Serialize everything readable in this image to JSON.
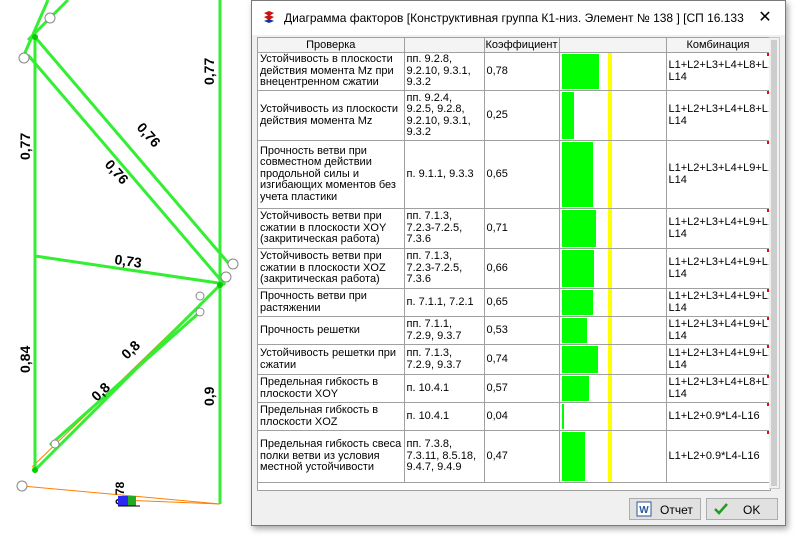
{
  "canvas": {
    "labels": {
      "top_diag_left": "0,77",
      "top_right_vert": "0,77",
      "diag_upper": "0,76",
      "diag_middle": "0,76",
      "horizontal": "0,73",
      "lower_left_vert": "0,84",
      "lower_diag_a": "0,8",
      "lower_diag_b": "0,8",
      "lower_right_vert": "0,9",
      "bottom_small": "0,78"
    }
  },
  "dialog": {
    "title": "Диаграмма факторов [Конструктивная группа К1-низ. Элемент № 138 ] [СП 16.13330...",
    "close_label": "✕",
    "columns": {
      "check": "Проверка",
      "clause": "",
      "coef": "Коэффициент",
      "bar": "",
      "combo": "Комбинация"
    },
    "rows": [
      {
        "check": "Устойчивость в плоскости действия момента Mz при внецентренном сжатии",
        "clause": "пп. 9.2.8, 9.2.10, 9.3.1, 9.3.2",
        "coef": "0,78",
        "value": 0.78,
        "combo": "L1+L2+L3+L4+L8+L12-L14"
      },
      {
        "check": "Устойчивость из плоскости действия момента Mz",
        "clause": "пп. 9.2.4, 9.2.5, 9.2.8, 9.2.10, 9.3.1, 9.3.2",
        "coef": "0,25",
        "value": 0.25,
        "combo": "L1+L2+L3+L4+L8+L12-L14"
      },
      {
        "check": "Прочность ветви при совместном действии продольной силы и изгибающих моментов без учета пластики",
        "clause": "п. 9.1.1, 9.3.3",
        "coef": "0,65",
        "value": 0.65,
        "combo": "L1+L2+L3+L4+L9+L12-L14"
      },
      {
        "check": "Устойчивость ветви при сжатии в плоскости XOY (закритическая работа)",
        "clause": "пп. 7.1.3, 7.2.3-7.2.5, 7.3.6",
        "coef": "0,71",
        "value": 0.71,
        "combo": "L1+L2+L3+L4+L9+L12-L14"
      },
      {
        "check": "Устойчивость ветви при сжатии в плоскости XOZ (закритическая работа)",
        "clause": "пп. 7.1.3, 7.2.3-7.2.5, 7.3.6",
        "coef": "0,66",
        "value": 0.66,
        "combo": "L1+L2+L3+L4+L9+L12-L14"
      },
      {
        "check": "Прочность ветви при растяжении",
        "clause": "п. 7.1.1, 7.2.1",
        "coef": "0,65",
        "value": 0.65,
        "combo": "L1+L2+L3+L4+L9+L12-L14"
      },
      {
        "check": "Прочность решетки",
        "clause": "пп. 7.1.1, 7.2.9, 9.3.7",
        "coef": "0,53",
        "value": 0.53,
        "combo": "L1+L2+L3+L4+L9+L12-L14"
      },
      {
        "check": "Устойчивость решетки при сжатии",
        "clause": "пп. 7.1.3, 7.2.9, 9.3.7",
        "coef": "0,74",
        "value": 0.74,
        "combo": "L1+L2+L3+L4+L9+L12-L14"
      },
      {
        "check": "Предельная гибкость в плоскости XOY",
        "clause": "п. 10.4.1",
        "coef": "0,57",
        "value": 0.57,
        "combo": "L1+L2+L3+L4+L8+L12-L14"
      },
      {
        "check": "Предельная гибкость в плоскости XOZ",
        "clause": "п. 10.4.1",
        "coef": "0,04",
        "value": 0.04,
        "combo": "L1+L2+0.9*L4-L16"
      },
      {
        "check": "Предельная гибкость свеса полки ветви из условия местной устойчивости",
        "clause": "пп. 7.3.8, 7.3.11, 8.5.18, 9.4.7, 9.4.9",
        "coef": "0,47",
        "value": 0.47,
        "combo": "L1+L2+0.9*L4-L16"
      }
    ],
    "limit_value": 1.0,
    "buttons": {
      "report": "Отчет",
      "ok": "OK"
    },
    "colors": {
      "bar": "#00ff00",
      "limit": "#ffff00",
      "mark": "#ff0000"
    }
  }
}
